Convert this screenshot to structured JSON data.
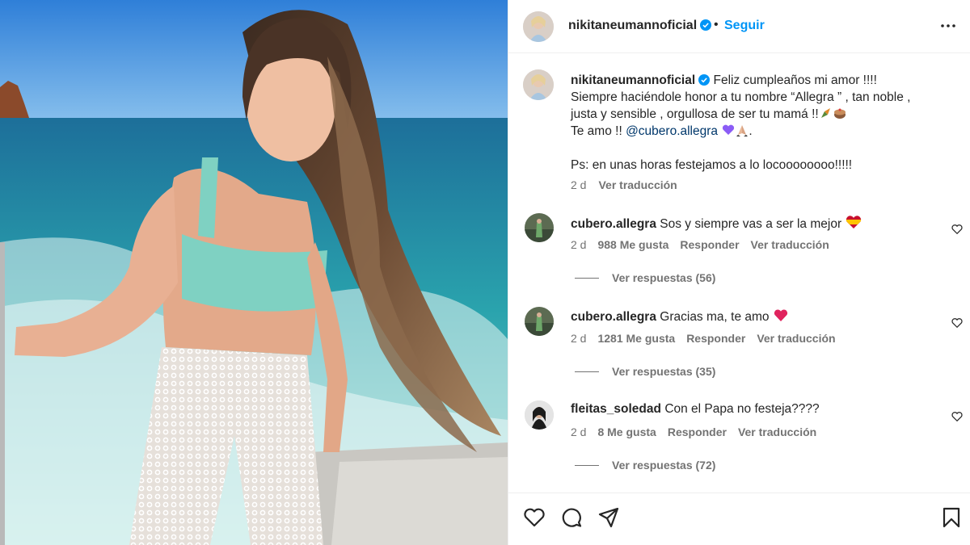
{
  "post": {
    "username": "nikitaneumannoficial",
    "dot": "•",
    "follow_label": "Seguir",
    "caption_lines": [
      "Feliz cumpleaños mi amor !!!!",
      "Siempre haciéndole honor a tu nombre “Allegra ” , tan noble ,",
      "justa y sensible , orgullosa de ser tu mamá !!",
      "Te amo !! ",
      "@cubero.allegra",
      ".",
      "Ps: en unas horas festejamos a lo locoooooooo!!!!!"
    ],
    "time": "2 d",
    "translate_label": "Ver traducción"
  },
  "comments": [
    {
      "username": "cubero.allegra",
      "text": "Sos y siempre vas a ser la mejor",
      "emoji": "heart-spain-icon",
      "time": "2 d",
      "likes": "988 Me gusta",
      "reply_label": "Responder",
      "translate_label": "Ver traducción",
      "replies_label": "Ver respuestas (56)"
    },
    {
      "username": "cubero.allegra",
      "text": "Gracias ma, te amo",
      "emoji": "red-heart-icon",
      "time": "2 d",
      "likes": "1281 Me gusta",
      "reply_label": "Responder",
      "translate_label": "Ver traducción",
      "replies_label": "Ver respuestas (35)"
    },
    {
      "username": "fleitas_soledad",
      "text": "Con el Papa no festeja????",
      "emoji": "",
      "time": "2 d",
      "likes": "8 Me gusta",
      "reply_label": "Responder",
      "translate_label": "Ver traducción",
      "replies_label": "Ver respuestas (72)"
    }
  ],
  "icons": {
    "verified": "verified-badge-icon",
    "more": "more-options-icon",
    "like": "heart-icon",
    "comment": "comment-icon",
    "share": "share-icon",
    "save": "bookmark-icon"
  },
  "colors": {
    "accent": "#0095f6",
    "verified": "#0095f6",
    "mention": "#00376b",
    "secondary_text": "#737373",
    "purple_heart": "#8b5cf6",
    "red_heart": "#e0245e"
  }
}
